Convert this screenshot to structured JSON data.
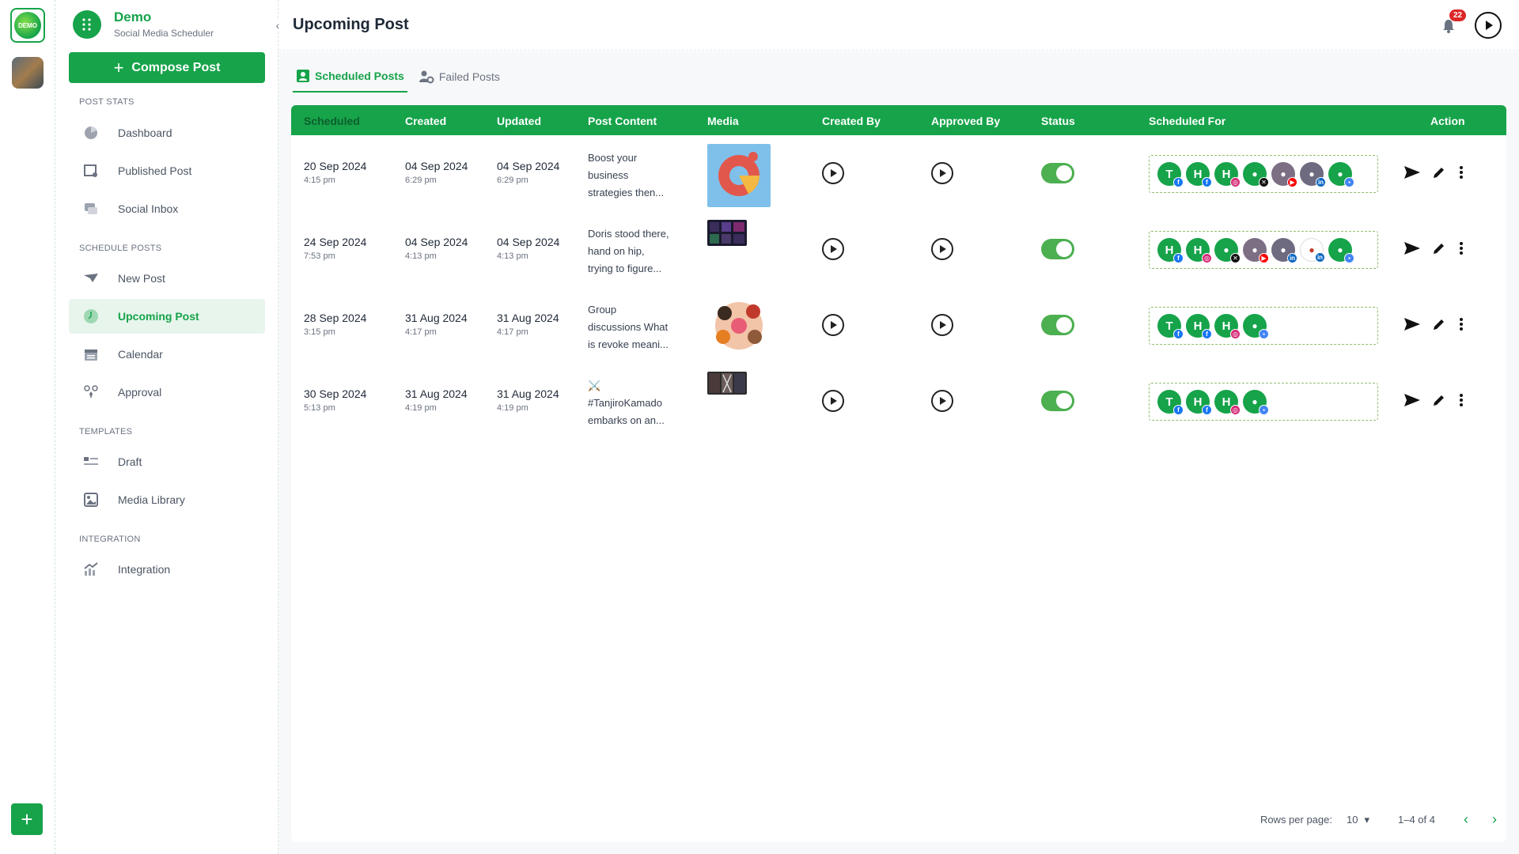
{
  "brand": {
    "name": "Demo",
    "subtitle": "Social Media Scheduler"
  },
  "compose_label": "Compose Post",
  "sidebar": {
    "sections": [
      {
        "title": "POST STATS"
      },
      {
        "title": "SCHEDULE POSTS"
      },
      {
        "title": "TEMPLATES"
      },
      {
        "title": "INTEGRATION"
      }
    ],
    "items": [
      {
        "label": "Dashboard",
        "icon": "dashboard-icon"
      },
      {
        "label": "Published Post",
        "icon": "published-icon"
      },
      {
        "label": "Social Inbox",
        "icon": "inbox-icon"
      },
      {
        "label": "New Post",
        "icon": "new-post-icon"
      },
      {
        "label": "Upcoming Post",
        "icon": "clock-icon",
        "active": true
      },
      {
        "label": "Calendar",
        "icon": "calendar-icon"
      },
      {
        "label": "Approval",
        "icon": "approval-icon"
      },
      {
        "label": "Draft",
        "icon": "draft-icon"
      },
      {
        "label": "Media Library",
        "icon": "media-icon"
      },
      {
        "label": "Integration",
        "icon": "integration-icon"
      }
    ]
  },
  "header": {
    "title": "Upcoming Post",
    "notification_count": "22",
    "avatar_text": "DEMO"
  },
  "tabs": [
    {
      "label": "Scheduled Posts"
    },
    {
      "label": "Failed Posts"
    }
  ],
  "table": {
    "columns": [
      "Scheduled",
      "Created",
      "Updated",
      "Post Content",
      "Media",
      "Created By",
      "Approved By",
      "Status",
      "Scheduled For",
      "Action"
    ],
    "rows": [
      {
        "scheduled_date": "20 Sep 2024",
        "scheduled_time": "4:15 pm",
        "created_date": "04 Sep 2024",
        "created_time": "6:29 pm",
        "updated_date": "04 Sep 2024",
        "updated_time": "6:29 pm",
        "content_lines": [
          "Boost your",
          "business",
          "strategies then..."
        ],
        "status_on": true,
        "accounts": [
          {
            "letter": "T",
            "bg": "#16a34a",
            "net": "facebook",
            "net_color": "#1877f2"
          },
          {
            "letter": "H",
            "bg": "#16a34a",
            "net": "facebook",
            "net_color": "#1877f2"
          },
          {
            "letter": "H",
            "bg": "#16a34a",
            "net": "instagram",
            "net_color": "#d62976"
          },
          {
            "letter": "",
            "bg": "#16a34a",
            "net": "x",
            "net_color": "#111111"
          },
          {
            "letter": "",
            "bg": "#7c6f84",
            "net": "youtube",
            "net_color": "#ff0000"
          },
          {
            "letter": "",
            "bg": "#6e6a80",
            "net": "linkedin",
            "net_color": "#0a66c2"
          },
          {
            "letter": "",
            "bg": "#16a34a",
            "net": "gmb",
            "net_color": "#4285f4"
          }
        ]
      },
      {
        "scheduled_date": "24 Sep 2024",
        "scheduled_time": "7:53 pm",
        "created_date": "04 Sep 2024",
        "created_time": "4:13 pm",
        "updated_date": "04 Sep 2024",
        "updated_time": "4:13 pm",
        "content_lines": [
          "Doris stood there,",
          "hand on hip,",
          "trying to figure..."
        ],
        "status_on": true,
        "accounts": [
          {
            "letter": "H",
            "bg": "#16a34a",
            "net": "facebook",
            "net_color": "#1877f2"
          },
          {
            "letter": "H",
            "bg": "#16a34a",
            "net": "instagram",
            "net_color": "#d62976"
          },
          {
            "letter": "",
            "bg": "#16a34a",
            "net": "x",
            "net_color": "#111111"
          },
          {
            "letter": "",
            "bg": "#7c6f84",
            "net": "youtube",
            "net_color": "#ff0000"
          },
          {
            "letter": "",
            "bg": "#6e6a80",
            "net": "linkedin",
            "net_color": "#0a66c2"
          },
          {
            "letter": "",
            "bg": "#ffffff",
            "net": "linkedin",
            "net_color": "#0a66c2"
          },
          {
            "letter": "",
            "bg": "#16a34a",
            "net": "gmb",
            "net_color": "#4285f4"
          }
        ]
      },
      {
        "scheduled_date": "28 Sep 2024",
        "scheduled_time": "3:15 pm",
        "created_date": "31 Aug 2024",
        "created_time": "4:17 pm",
        "updated_date": "31 Aug 2024",
        "updated_time": "4:17 pm",
        "content_lines": [
          "Group",
          "discussions What",
          "is revoke meani..."
        ],
        "status_on": true,
        "accounts": [
          {
            "letter": "T",
            "bg": "#16a34a",
            "net": "facebook",
            "net_color": "#1877f2"
          },
          {
            "letter": "H",
            "bg": "#16a34a",
            "net": "facebook",
            "net_color": "#1877f2"
          },
          {
            "letter": "H",
            "bg": "#16a34a",
            "net": "instagram",
            "net_color": "#d62976"
          },
          {
            "letter": "",
            "bg": "#16a34a",
            "net": "gmb",
            "net_color": "#4285f4"
          }
        ]
      },
      {
        "scheduled_date": "30 Sep 2024",
        "scheduled_time": "5:13 pm",
        "created_date": "31 Aug 2024",
        "created_time": "4:19 pm",
        "updated_date": "31 Aug 2024",
        "updated_time": "4:19 pm",
        "content_lines": [
          "⚔️",
          "#TanjiroKamado",
          "embarks on an..."
        ],
        "status_on": true,
        "accounts": [
          {
            "letter": "T",
            "bg": "#16a34a",
            "net": "facebook",
            "net_color": "#1877f2"
          },
          {
            "letter": "H",
            "bg": "#16a34a",
            "net": "facebook",
            "net_color": "#1877f2"
          },
          {
            "letter": "H",
            "bg": "#16a34a",
            "net": "instagram",
            "net_color": "#d62976"
          },
          {
            "letter": "",
            "bg": "#16a34a",
            "net": "gmb",
            "net_color": "#4285f4"
          }
        ]
      }
    ]
  },
  "pagination": {
    "rows_per_page_label": "Rows per page:",
    "rows_per_page": "10",
    "range": "1–4 of 4"
  },
  "colors": {
    "accent": "#16a34a",
    "accent_light": "#e8f5ec",
    "badge": "#dc2626",
    "toggle": "#4caf50"
  }
}
